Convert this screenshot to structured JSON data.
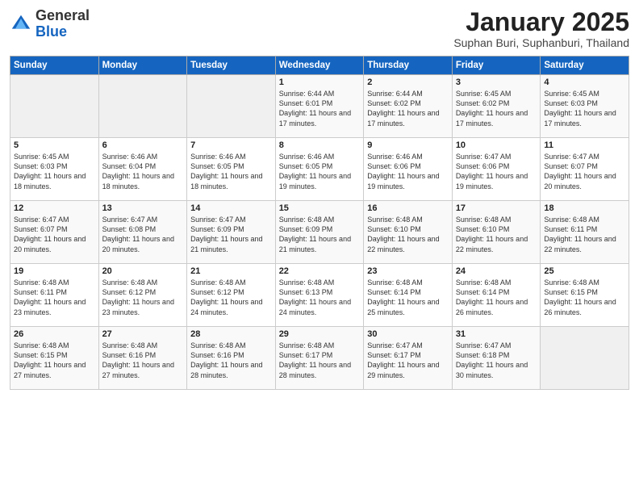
{
  "header": {
    "logo_general": "General",
    "logo_blue": "Blue",
    "month_title": "January 2025",
    "subtitle": "Suphan Buri, Suphanburi, Thailand"
  },
  "days_of_week": [
    "Sunday",
    "Monday",
    "Tuesday",
    "Wednesday",
    "Thursday",
    "Friday",
    "Saturday"
  ],
  "weeks": [
    [
      {
        "day": "",
        "info": ""
      },
      {
        "day": "",
        "info": ""
      },
      {
        "day": "",
        "info": ""
      },
      {
        "day": "1",
        "info": "Sunrise: 6:44 AM\nSunset: 6:01 PM\nDaylight: 11 hours and 17 minutes."
      },
      {
        "day": "2",
        "info": "Sunrise: 6:44 AM\nSunset: 6:02 PM\nDaylight: 11 hours and 17 minutes."
      },
      {
        "day": "3",
        "info": "Sunrise: 6:45 AM\nSunset: 6:02 PM\nDaylight: 11 hours and 17 minutes."
      },
      {
        "day": "4",
        "info": "Sunrise: 6:45 AM\nSunset: 6:03 PM\nDaylight: 11 hours and 17 minutes."
      }
    ],
    [
      {
        "day": "5",
        "info": "Sunrise: 6:45 AM\nSunset: 6:03 PM\nDaylight: 11 hours and 18 minutes."
      },
      {
        "day": "6",
        "info": "Sunrise: 6:46 AM\nSunset: 6:04 PM\nDaylight: 11 hours and 18 minutes."
      },
      {
        "day": "7",
        "info": "Sunrise: 6:46 AM\nSunset: 6:05 PM\nDaylight: 11 hours and 18 minutes."
      },
      {
        "day": "8",
        "info": "Sunrise: 6:46 AM\nSunset: 6:05 PM\nDaylight: 11 hours and 19 minutes."
      },
      {
        "day": "9",
        "info": "Sunrise: 6:46 AM\nSunset: 6:06 PM\nDaylight: 11 hours and 19 minutes."
      },
      {
        "day": "10",
        "info": "Sunrise: 6:47 AM\nSunset: 6:06 PM\nDaylight: 11 hours and 19 minutes."
      },
      {
        "day": "11",
        "info": "Sunrise: 6:47 AM\nSunset: 6:07 PM\nDaylight: 11 hours and 20 minutes."
      }
    ],
    [
      {
        "day": "12",
        "info": "Sunrise: 6:47 AM\nSunset: 6:07 PM\nDaylight: 11 hours and 20 minutes."
      },
      {
        "day": "13",
        "info": "Sunrise: 6:47 AM\nSunset: 6:08 PM\nDaylight: 11 hours and 20 minutes."
      },
      {
        "day": "14",
        "info": "Sunrise: 6:47 AM\nSunset: 6:09 PM\nDaylight: 11 hours and 21 minutes."
      },
      {
        "day": "15",
        "info": "Sunrise: 6:48 AM\nSunset: 6:09 PM\nDaylight: 11 hours and 21 minutes."
      },
      {
        "day": "16",
        "info": "Sunrise: 6:48 AM\nSunset: 6:10 PM\nDaylight: 11 hours and 22 minutes."
      },
      {
        "day": "17",
        "info": "Sunrise: 6:48 AM\nSunset: 6:10 PM\nDaylight: 11 hours and 22 minutes."
      },
      {
        "day": "18",
        "info": "Sunrise: 6:48 AM\nSunset: 6:11 PM\nDaylight: 11 hours and 22 minutes."
      }
    ],
    [
      {
        "day": "19",
        "info": "Sunrise: 6:48 AM\nSunset: 6:11 PM\nDaylight: 11 hours and 23 minutes."
      },
      {
        "day": "20",
        "info": "Sunrise: 6:48 AM\nSunset: 6:12 PM\nDaylight: 11 hours and 23 minutes."
      },
      {
        "day": "21",
        "info": "Sunrise: 6:48 AM\nSunset: 6:12 PM\nDaylight: 11 hours and 24 minutes."
      },
      {
        "day": "22",
        "info": "Sunrise: 6:48 AM\nSunset: 6:13 PM\nDaylight: 11 hours and 24 minutes."
      },
      {
        "day": "23",
        "info": "Sunrise: 6:48 AM\nSunset: 6:14 PM\nDaylight: 11 hours and 25 minutes."
      },
      {
        "day": "24",
        "info": "Sunrise: 6:48 AM\nSunset: 6:14 PM\nDaylight: 11 hours and 26 minutes."
      },
      {
        "day": "25",
        "info": "Sunrise: 6:48 AM\nSunset: 6:15 PM\nDaylight: 11 hours and 26 minutes."
      }
    ],
    [
      {
        "day": "26",
        "info": "Sunrise: 6:48 AM\nSunset: 6:15 PM\nDaylight: 11 hours and 27 minutes."
      },
      {
        "day": "27",
        "info": "Sunrise: 6:48 AM\nSunset: 6:16 PM\nDaylight: 11 hours and 27 minutes."
      },
      {
        "day": "28",
        "info": "Sunrise: 6:48 AM\nSunset: 6:16 PM\nDaylight: 11 hours and 28 minutes."
      },
      {
        "day": "29",
        "info": "Sunrise: 6:48 AM\nSunset: 6:17 PM\nDaylight: 11 hours and 28 minutes."
      },
      {
        "day": "30",
        "info": "Sunrise: 6:47 AM\nSunset: 6:17 PM\nDaylight: 11 hours and 29 minutes."
      },
      {
        "day": "31",
        "info": "Sunrise: 6:47 AM\nSunset: 6:18 PM\nDaylight: 11 hours and 30 minutes."
      },
      {
        "day": "",
        "info": ""
      }
    ]
  ]
}
